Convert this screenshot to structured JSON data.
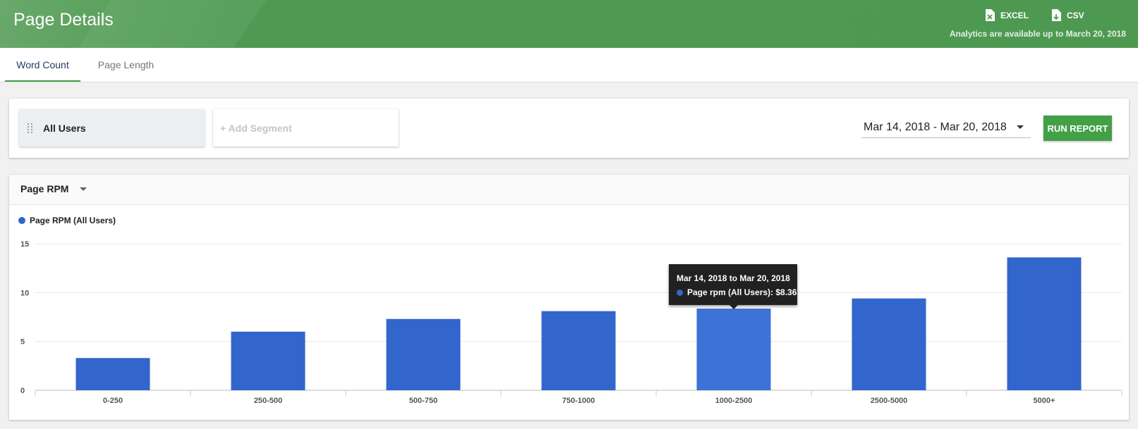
{
  "header": {
    "title": "Page Details",
    "excel_label": "EXCEL",
    "csv_label": "CSV",
    "availability": "Analytics are available up to March 20, 2018"
  },
  "tabs": [
    {
      "label": "Word Count",
      "active": true
    },
    {
      "label": "Page Length",
      "active": false
    }
  ],
  "segments": {
    "selected": "All Users",
    "add_label": "+ Add Segment"
  },
  "date_range": "Mar 14, 2018 - Mar 20, 2018",
  "run_report_label": "RUN REPORT",
  "metric_selector": "Page RPM",
  "tooltip": {
    "title": "Mar 14, 2018 to Mar 20, 2018",
    "line": "Page rpm (All Users): $8.36"
  },
  "colors": {
    "header_green": "#4e9952",
    "button_green": "#43a047",
    "bar_blue": "#3366cc",
    "bar_highlight": "#3d72d6"
  },
  "chart_data": {
    "type": "bar",
    "categories": [
      "0-250",
      "250-500",
      "500-750",
      "750-1000",
      "1000-2500",
      "2500-5000",
      "5000+"
    ],
    "series": [
      {
        "name": "Page RPM (All Users)",
        "values": [
          3.3,
          6.0,
          7.3,
          8.1,
          8.36,
          9.4,
          13.6
        ]
      }
    ],
    "yticks": [
      0,
      5,
      10,
      15
    ],
    "ylim": [
      0,
      15
    ],
    "highlighted_index": 4,
    "legend": "top-left",
    "grid": true
  }
}
